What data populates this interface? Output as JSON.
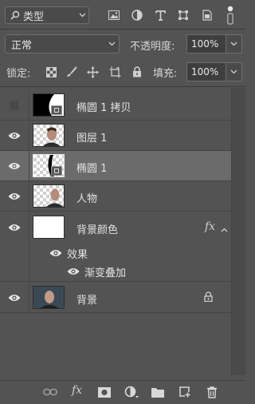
{
  "filter": {
    "kind_label": "类型"
  },
  "blend": {
    "mode": "正常",
    "opacity_label": "不透明度:",
    "opacity_value": "100%"
  },
  "lock": {
    "label": "锁定:",
    "fill_label": "填充:",
    "fill_value": "100%"
  },
  "layers": [
    {
      "name": "椭圆 1 拷贝",
      "visible": false,
      "selected": false
    },
    {
      "name": "图层 1",
      "visible": true,
      "selected": false
    },
    {
      "name": "椭圆 1",
      "visible": true,
      "selected": true
    },
    {
      "name": "人物",
      "visible": true,
      "selected": false
    },
    {
      "name": "背景颜色",
      "visible": true,
      "selected": false,
      "fx": "fx"
    },
    {
      "name": "背景",
      "visible": true,
      "selected": false,
      "locked": true
    }
  ],
  "effects": {
    "label": "效果",
    "items": [
      "渐变叠加"
    ]
  },
  "bottom": {
    "fx_label": "fx"
  },
  "colors": {
    "panel": "#535353",
    "selected_row": "#6b6b6b",
    "text": "#e2e2e2"
  }
}
